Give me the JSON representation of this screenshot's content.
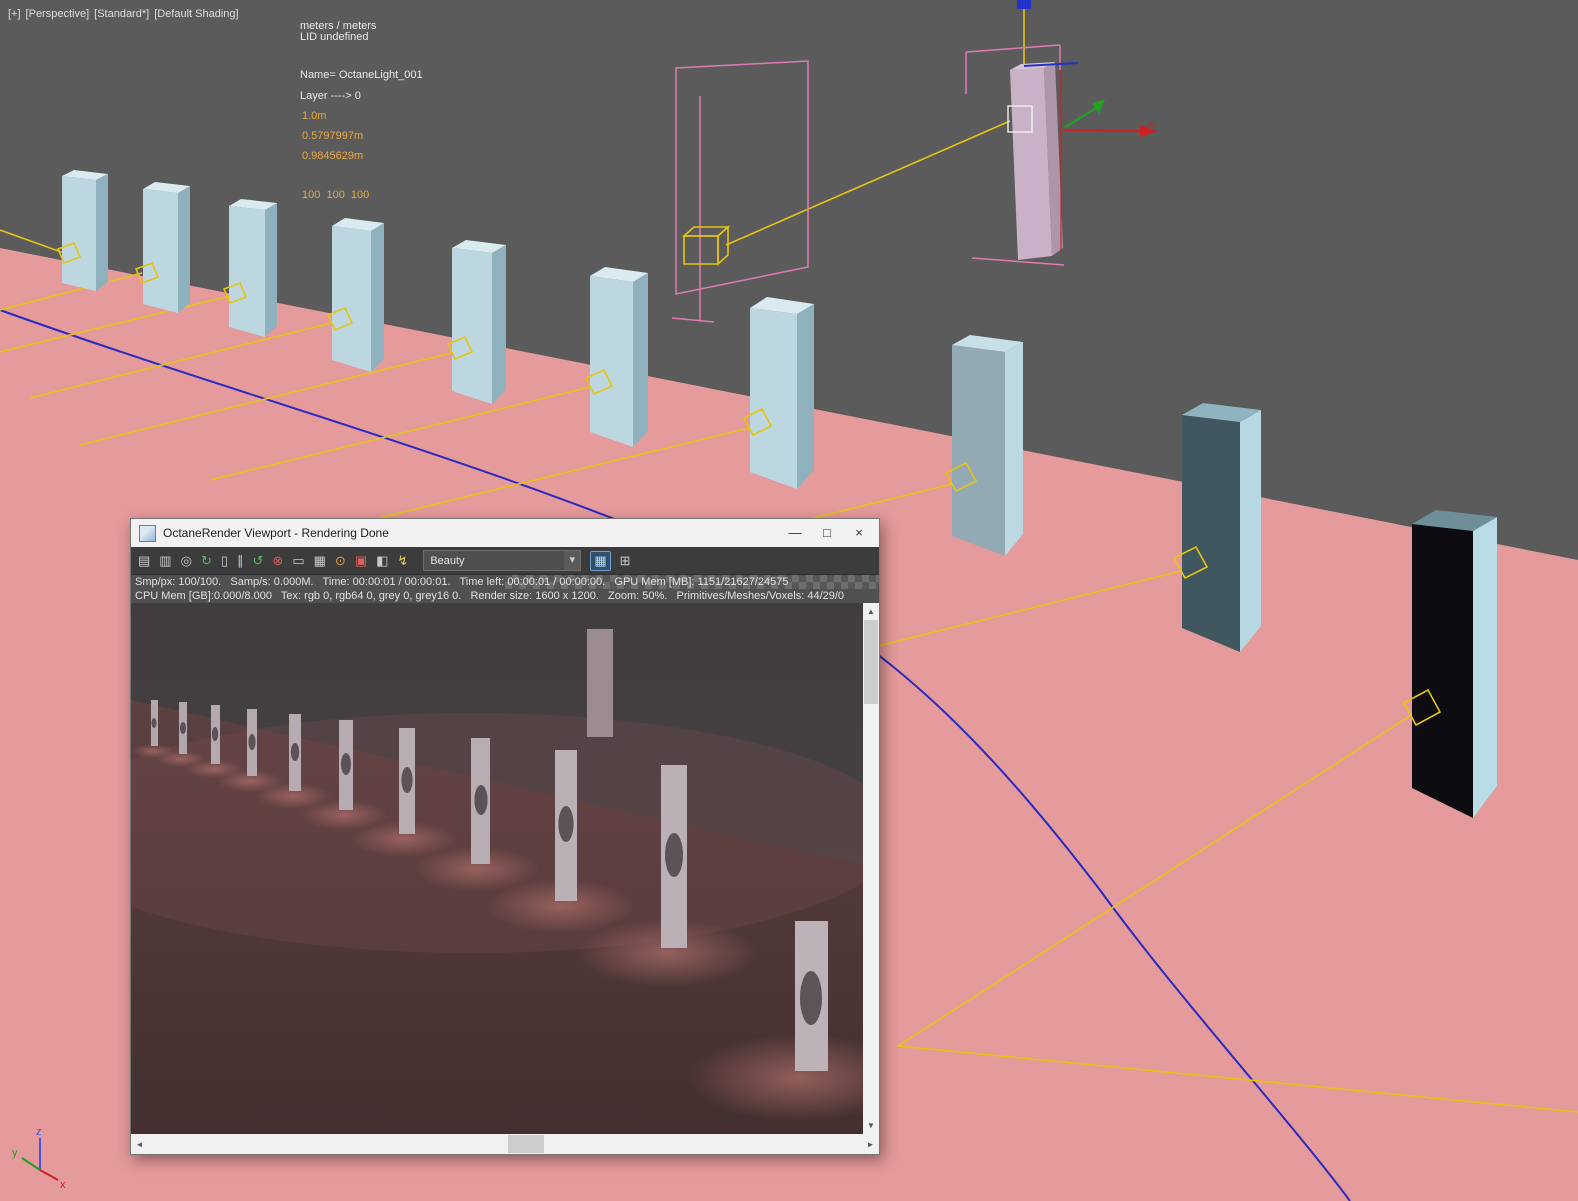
{
  "viewport": {
    "label_parts": [
      "[+]",
      "[Perspective]",
      "[Standard*]",
      "[Default Shading]"
    ],
    "hud": {
      "units": "meters / meters",
      "lid": "LID undefined",
      "name": "Name= OctaneLight_001",
      "layer": "Layer ----> 0",
      "length": "1.0m",
      "width": "0.5797997m",
      "height": "0.9845629m",
      "rgb": "100  100  100"
    },
    "axis_labels": {
      "x": "x",
      "y": "y",
      "z": "z"
    }
  },
  "render_window": {
    "title": "OctaneRender Viewport - Rendering Done",
    "controls": {
      "minimize": "—",
      "maximize": "□",
      "close": "×"
    },
    "toolbar": {
      "icons": [
        {
          "name": "save-render",
          "glyph": "▤"
        },
        {
          "name": "copy-image",
          "glyph": "▥"
        },
        {
          "name": "zoom-fit",
          "glyph": "◎"
        },
        {
          "name": "refresh-render",
          "glyph": "↻"
        },
        {
          "name": "lock-resolution",
          "glyph": "▯"
        },
        {
          "name": "pause-render",
          "glyph": "∥"
        },
        {
          "name": "restart-render",
          "glyph": "↺"
        },
        {
          "name": "stop-render",
          "glyph": "⊗"
        },
        {
          "name": "region-render",
          "glyph": "▭"
        },
        {
          "name": "subsampling",
          "glyph": "▦"
        },
        {
          "name": "material-picker",
          "glyph": "⊙"
        },
        {
          "name": "focus-picker",
          "glyph": "▣"
        },
        {
          "name": "white-balance-picker",
          "glyph": "◧"
        },
        {
          "name": "render-priority",
          "glyph": "↯"
        },
        {
          "name": "render-passes",
          "glyph": "▦"
        },
        {
          "name": "render-layers",
          "glyph": "⊞"
        }
      ],
      "pass_dropdown": {
        "value": "Beauty",
        "arrow": "▾"
      }
    },
    "stats": {
      "line1": "Smp/px: 100/100.   Samp/s: 0.000M.   Time: 00:00:01 / 00:00:01.   Time left: 00:00:01 / 00:00:00.   GPU Mem [MB]: 1151/21627/24575",
      "line2": "CPU Mem [GB]:0.000/8.000   Tex: rgb 0, rgb64 0, grey 0, grey16 0.   Render size: 1600 x 1200.   Zoom: 50%.   Primitives/Meshes/Voxels: 44/29/0"
    },
    "scrollbar": {
      "up": "▲",
      "down": "▼",
      "left": "◄",
      "right": "►"
    }
  },
  "colors": {
    "floor_pink": "#e59a9b",
    "pillar_blue": "#bdd7e0",
    "target_yellow": "#e6c413",
    "spline_blue": "#2a2ac0",
    "gizmo_x": "#cc2222",
    "gizmo_y": "#22a022",
    "gizmo_z": "#2233cc",
    "wireframe_pink": "#e07ab5"
  }
}
